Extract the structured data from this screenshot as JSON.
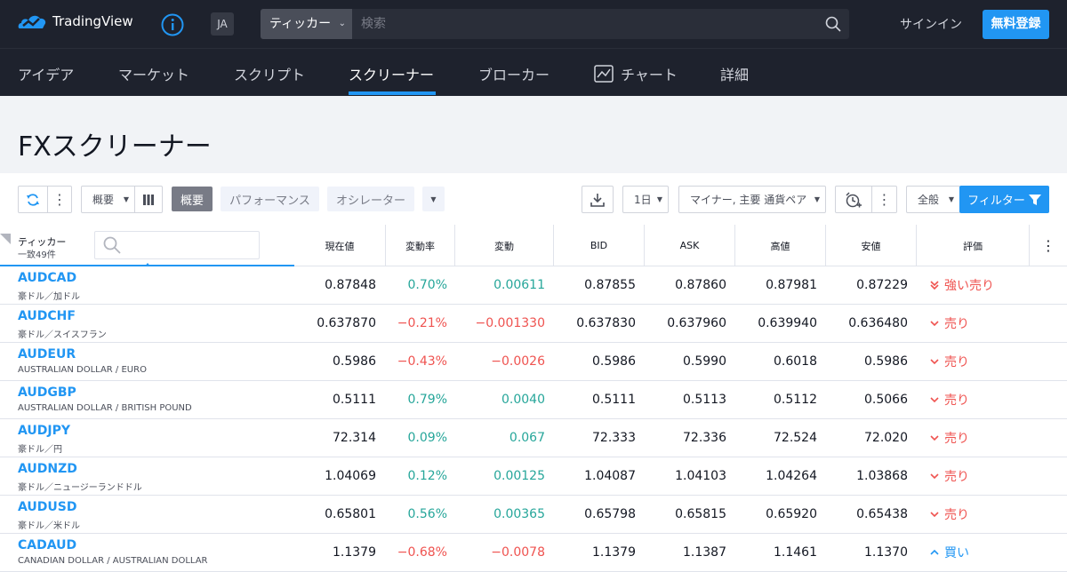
{
  "header": {
    "brand": "TradingView",
    "lang": "JA",
    "ticker_select": "ティッカー",
    "search_placeholder": "検索",
    "signin": "サインイン",
    "register": "無料登録"
  },
  "nav": {
    "items": [
      "アイデア",
      "マーケット",
      "スクリプト",
      "スクリーナー",
      "ブローカー",
      "チャート",
      "詳細"
    ],
    "active": "スクリーナー"
  },
  "page": {
    "title": "FXスクリーナー"
  },
  "toolbar": {
    "overview_select": "概要",
    "tab_overview": "概要",
    "tab_performance": "パフォーマンス",
    "tab_oscillator": "オシレーター",
    "interval": "1日",
    "pair_filter": "マイナー, 主要 通貨ペア",
    "general": "全般",
    "filter": "フィルター"
  },
  "table": {
    "ticker_header": "ティッカー",
    "match_count": "一致49件",
    "columns": [
      "現在値",
      "変動率",
      "変動",
      "BID",
      "ASK",
      "高値",
      "安値",
      "評価"
    ],
    "rows": [
      {
        "symbol": "AUDCAD",
        "desc": "豪ドル／加ドル",
        "last": "0.87848",
        "chg_pct": "0.70%",
        "chg": "0.00611",
        "bid": "0.87855",
        "ask": "0.87860",
        "high": "0.87981",
        "low": "0.87229",
        "rating": "強い売り",
        "dir": "pos",
        "rtype": "strong-sell"
      },
      {
        "symbol": "AUDCHF",
        "desc": "豪ドル／スイスフラン",
        "last": "0.637870",
        "chg_pct": "−0.21%",
        "chg": "−0.001330",
        "bid": "0.637830",
        "ask": "0.637960",
        "high": "0.639940",
        "low": "0.636480",
        "rating": "売り",
        "dir": "neg",
        "rtype": "sell"
      },
      {
        "symbol": "AUDEUR",
        "desc": "AUSTRALIAN DOLLAR / EURO",
        "last": "0.5986",
        "chg_pct": "−0.43%",
        "chg": "−0.0026",
        "bid": "0.5986",
        "ask": "0.5990",
        "high": "0.6018",
        "low": "0.5986",
        "rating": "売り",
        "dir": "neg",
        "rtype": "sell"
      },
      {
        "symbol": "AUDGBP",
        "desc": "AUSTRALIAN DOLLAR / BRITISH POUND",
        "last": "0.5111",
        "chg_pct": "0.79%",
        "chg": "0.0040",
        "bid": "0.5111",
        "ask": "0.5113",
        "high": "0.5112",
        "low": "0.5066",
        "rating": "売り",
        "dir": "pos",
        "rtype": "sell"
      },
      {
        "symbol": "AUDJPY",
        "desc": "豪ドル／円",
        "last": "72.314",
        "chg_pct": "0.09%",
        "chg": "0.067",
        "bid": "72.333",
        "ask": "72.336",
        "high": "72.524",
        "low": "72.020",
        "rating": "売り",
        "dir": "pos",
        "rtype": "sell"
      },
      {
        "symbol": "AUDNZD",
        "desc": "豪ドル／ニュージーランドドル",
        "last": "1.04069",
        "chg_pct": "0.12%",
        "chg": "0.00125",
        "bid": "1.04087",
        "ask": "1.04103",
        "high": "1.04264",
        "low": "1.03868",
        "rating": "売り",
        "dir": "pos",
        "rtype": "sell"
      },
      {
        "symbol": "AUDUSD",
        "desc": "豪ドル／米ドル",
        "last": "0.65801",
        "chg_pct": "0.56%",
        "chg": "0.00365",
        "bid": "0.65798",
        "ask": "0.65815",
        "high": "0.65920",
        "low": "0.65438",
        "rating": "売り",
        "dir": "pos",
        "rtype": "sell"
      },
      {
        "symbol": "CADAUD",
        "desc": "CANADIAN DOLLAR / AUSTRALIAN DOLLAR",
        "last": "1.1379",
        "chg_pct": "−0.68%",
        "chg": "−0.0078",
        "bid": "1.1379",
        "ask": "1.1387",
        "high": "1.1461",
        "low": "1.1370",
        "rating": "買い",
        "dir": "neg",
        "rtype": "buy"
      }
    ]
  },
  "colors": {
    "accent": "#2196f3",
    "positive": "#26a69a",
    "negative": "#ef5350",
    "header_bg": "#1e222d"
  }
}
